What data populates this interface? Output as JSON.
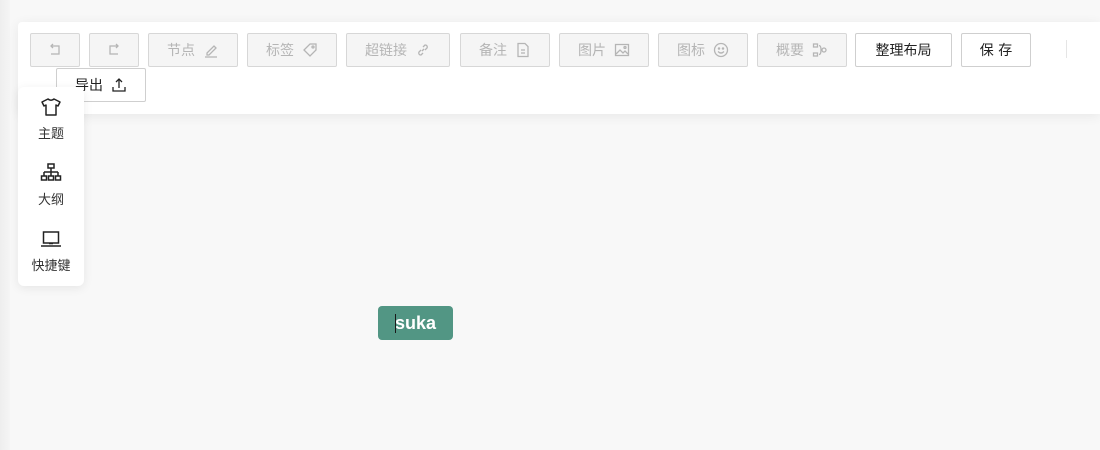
{
  "toolbar": {
    "buttons": [
      {
        "name": "undo-button",
        "label": "",
        "icon": "undo-icon",
        "enabled": false
      },
      {
        "name": "redo-button",
        "label": "",
        "icon": "redo-icon",
        "enabled": false
      },
      {
        "name": "node-button",
        "label": "节点",
        "icon": "pencil-icon",
        "enabled": false
      },
      {
        "name": "tag-button",
        "label": "标签",
        "icon": "tag-icon",
        "enabled": false
      },
      {
        "name": "hyperlink-button",
        "label": "超链接",
        "icon": "link-icon",
        "enabled": false
      },
      {
        "name": "note-button",
        "label": "备注",
        "icon": "document-icon",
        "enabled": false
      },
      {
        "name": "image-button",
        "label": "图片",
        "icon": "image-icon",
        "enabled": false
      },
      {
        "name": "icon-button",
        "label": "图标",
        "icon": "smiley-icon",
        "enabled": false
      },
      {
        "name": "summary-button",
        "label": "概要",
        "icon": "summary-icon",
        "enabled": false
      },
      {
        "name": "arrange-layout-button",
        "label": "整理布局",
        "icon": "",
        "enabled": true
      },
      {
        "name": "save-button",
        "label": "保 存",
        "icon": "",
        "enabled": true
      },
      {
        "name": "export-button",
        "label": "导出",
        "icon": "export-icon",
        "enabled": true
      }
    ]
  },
  "sidebar": {
    "items": [
      {
        "label": "主题",
        "icon": "tshirt-icon"
      },
      {
        "label": "大纲",
        "icon": "outline-tree-icon"
      },
      {
        "label": "快捷键",
        "icon": "laptop-icon"
      }
    ]
  },
  "canvas": {
    "root_node": {
      "text": "suka",
      "color": "#529684"
    }
  },
  "colors": {
    "node_bg": "#529684",
    "disabled_text": "#b5b5b5",
    "canvas_bg": "#f8f8f8"
  }
}
